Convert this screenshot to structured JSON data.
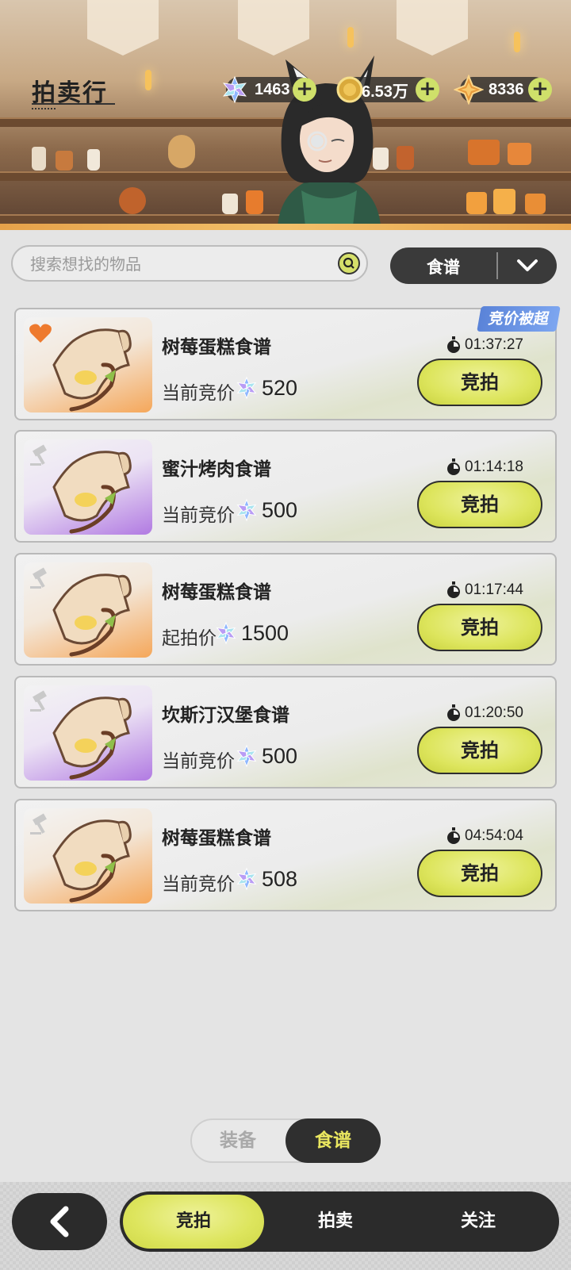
{
  "header": {
    "title": "拍卖行",
    "currencies": [
      {
        "icon": "snowflake-gem-icon",
        "value": "1463"
      },
      {
        "icon": "gold-coin-icon",
        "value": "6.53万"
      },
      {
        "icon": "star-crystal-icon",
        "value": "8336"
      }
    ]
  },
  "search": {
    "placeholder": "搜索想找的物品",
    "value": ""
  },
  "filter": {
    "selected": "食谱"
  },
  "items": [
    {
      "name": "树莓蛋糕食谱",
      "price_label": "当前竞价",
      "price": "520",
      "timer": "01:37:27",
      "bid_label": "竞拍",
      "status_badge": "竞价被超",
      "tag": "heart-icon",
      "rarity": "orange"
    },
    {
      "name": "蜜汁烤肉食谱",
      "price_label": "当前竞价",
      "price": "500",
      "timer": "01:14:18",
      "bid_label": "竞拍",
      "tag": "gavel-icon",
      "rarity": "purple"
    },
    {
      "name": "树莓蛋糕食谱",
      "price_label": "起拍价",
      "price": "1500",
      "timer": "01:17:44",
      "bid_label": "竞拍",
      "tag": "gavel-icon",
      "rarity": "orange"
    },
    {
      "name": "坎斯汀汉堡食谱",
      "price_label": "当前竞价",
      "price": "500",
      "timer": "01:20:50",
      "bid_label": "竞拍",
      "tag": "gavel-icon",
      "rarity": "purple"
    },
    {
      "name": "树莓蛋糕食谱",
      "price_label": "当前竞价",
      "price": "508",
      "timer": "04:54:04",
      "bid_label": "竞拍",
      "tag": "gavel-icon",
      "rarity": "orange"
    }
  ],
  "category_toggle": {
    "options": [
      "装备",
      "食谱"
    ],
    "selected": "食谱"
  },
  "bottom_nav": {
    "tabs": [
      "竞拍",
      "拍卖",
      "关注"
    ],
    "selected": "竞拍"
  },
  "colors": {
    "accent": "#dde55d",
    "dark": "#2b2b2b",
    "outbid": "#5a83d8"
  }
}
